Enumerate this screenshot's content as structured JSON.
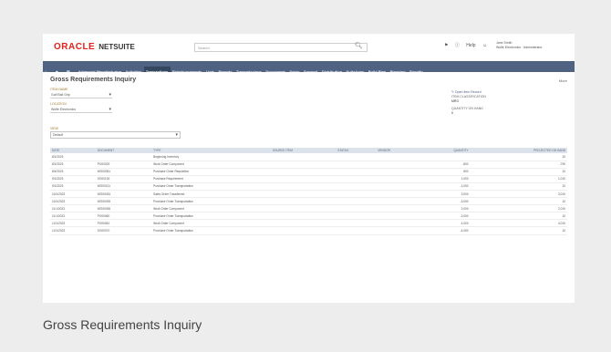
{
  "app": {
    "brand_oracle": "ORACLE",
    "brand_netsuite": "NETSUITE"
  },
  "header": {
    "search_placeholder": "Search",
    "help_label": "Help",
    "user_name": "Jane Smith",
    "user_role": "Wolfe Electronics · Administrator"
  },
  "nav": {
    "items": [
      "Advanced Manufacturing",
      "Activities",
      "Transactions",
      "Reimbursements",
      "Lists",
      "Reports",
      "Transmissions",
      "Documents",
      "Setup",
      "Support",
      "Distribution",
      "SuiteApps",
      "Build Plan",
      "Planning",
      "Shopify"
    ],
    "active_index": 2
  },
  "page": {
    "title": "Gross Requirements Inquiry",
    "more_label": "More"
  },
  "filters": {
    "item_label": "ITEM NAME",
    "item_value": "Golf Ball Grip",
    "location_label": "LOCATION",
    "location_value": "Wolfe Electronics",
    "view_label": "VIEW",
    "view_value": "Default"
  },
  "right_panel": {
    "action_label": "Open Item Record",
    "quantity_label": "ITEM CLASSIFICATION",
    "quantity_value": "MRO",
    "onhand_label": "QUANTITY ON HAND",
    "onhand_value": "0"
  },
  "table": {
    "headers": [
      "DATE",
      "DOCUMENT",
      "TYPE",
      "SOURCE ITEM",
      "STATUS",
      "VENDOR",
      "QUANTITY",
      "PROJECTED ON HAND"
    ],
    "rows": [
      [
        "8/1/2023",
        "",
        "Beginning Inventory",
        "",
        "",
        "",
        "",
        "10"
      ],
      [
        "8/1/2023",
        "PO00029",
        "Work Order Component",
        "",
        "",
        "",
        "-800",
        "-790"
      ],
      [
        "8/4/2023",
        "WO00051",
        "Purchase Order Requisition",
        "",
        "",
        "",
        "800",
        "10"
      ],
      [
        "9/1/2023",
        "SO00126",
        "Purchase Requirement",
        "",
        "",
        "",
        "1,000",
        "1,010"
      ],
      [
        "9/1/2023",
        "WO00131",
        "Purchase Order Transportation",
        "",
        "",
        "",
        "-1,000",
        "10"
      ],
      [
        "10/1/2023",
        "WO00034",
        "Sales Order Transferred",
        "",
        "",
        "",
        "3,000",
        "3,010"
      ],
      [
        "10/1/2023",
        "WO00035",
        "Purchase Order Transportation",
        "",
        "",
        "",
        "-3,000",
        "10"
      ],
      [
        "11/1/2023",
        "WO00036",
        "Work Order Component",
        "",
        "",
        "",
        "2,000",
        "2,010"
      ],
      [
        "11/1/2023",
        "PO00060",
        "Purchase Order Transportation",
        "",
        "",
        "",
        "-2,000",
        "10"
      ],
      [
        "12/1/2023",
        "PO00061",
        "Work Order Component",
        "",
        "",
        "",
        "4,000",
        "4,010"
      ],
      [
        "12/1/2023",
        "SO00070",
        "Purchase Order Transportation",
        "",
        "",
        "",
        "-4,000",
        "10"
      ]
    ]
  },
  "caption": "Gross Requirements Inquiry"
}
